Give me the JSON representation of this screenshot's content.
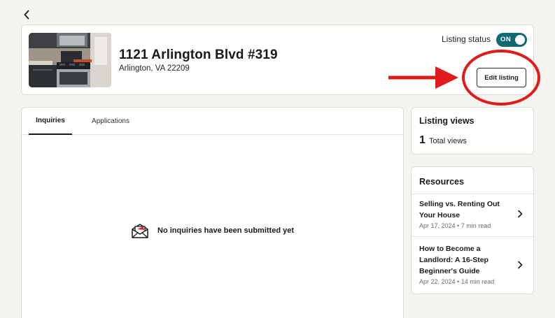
{
  "listing": {
    "address": "1121 Arlington Blvd #319",
    "city_state_zip": "Arlington, VA 22209",
    "status_label": "Listing status",
    "status_toggle": "ON",
    "edit_button": "Edit listing"
  },
  "tabs": [
    {
      "label": "Inquiries",
      "active": true
    },
    {
      "label": "Applications",
      "active": false
    }
  ],
  "inquiries": {
    "empty_message": "No inquiries have been submitted yet"
  },
  "views": {
    "title": "Listing views",
    "count": "1",
    "count_label": "Total views"
  },
  "resources": {
    "title": "Resources",
    "articles": [
      {
        "title": "Selling vs. Renting Out Your House",
        "meta": "Apr 17, 2024 • 7 min read"
      },
      {
        "title": "How to Become a Landlord: A 16-Step Beginner's Guide",
        "meta": "Apr 22, 2024 • 14 min read"
      }
    ]
  },
  "colors": {
    "toggle_on": "#0f6a73",
    "annotation_red": "#e01b1b",
    "page_background": "#f6f4f1"
  },
  "icons": [
    "back-chevron-icon",
    "envelope-icon",
    "chevron-right-icon"
  ]
}
